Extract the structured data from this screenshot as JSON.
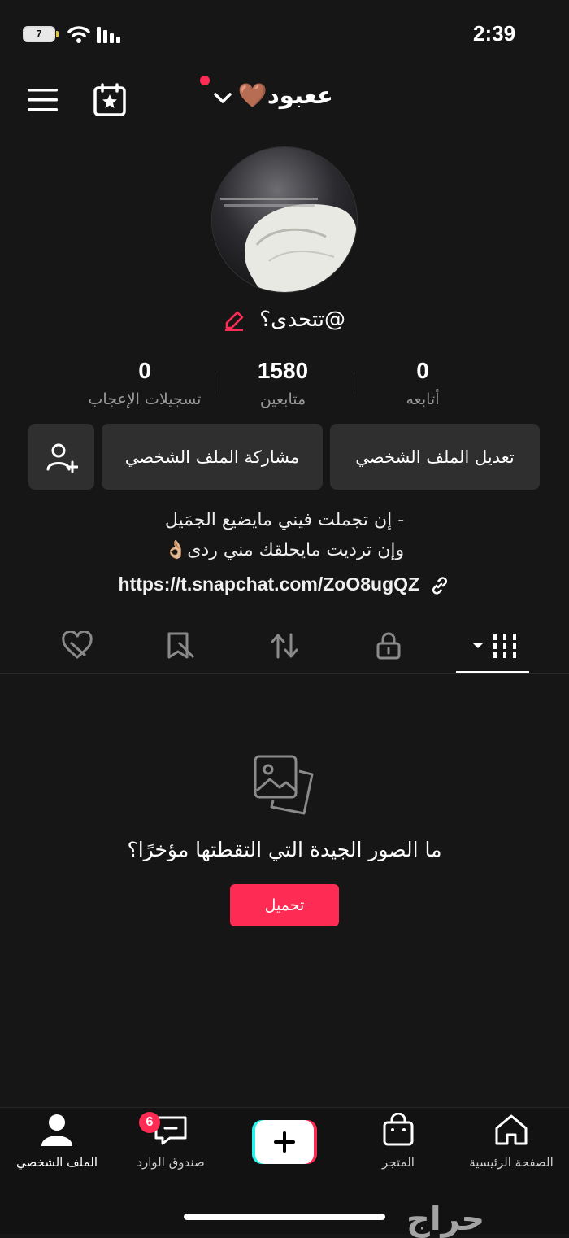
{
  "status": {
    "time": "2:39",
    "battery": "7"
  },
  "header": {
    "username": "ععبود🤎",
    "menu_icon": "hamburger-menu-icon",
    "calendar_icon": "calendar-star-icon"
  },
  "profile": {
    "handle": "@تتحدى؟",
    "stats": [
      {
        "value": "0",
        "label": "تسجيلات الإعجاب"
      },
      {
        "value": "1580",
        "label": "متابعين"
      },
      {
        "value": "0",
        "label": "أتابعه"
      }
    ],
    "edit_profile": "تعديل الملف الشخصي",
    "share_profile": "مشاركة الملف الشخصي",
    "bio_line1": "- إن تجملت فيني مايضيع الجمَيل",
    "bio_line2": "وإن ترديت مايحلقك مني ردى👌🏼",
    "link": "https://t.snapchat.com/ZoO8ugQZ"
  },
  "tabs": [
    "videos-grid",
    "private-lock",
    "reposts",
    "favorites",
    "liked"
  ],
  "empty_state": {
    "title": "ما الصور الجيدة التي التقطتها مؤخرًا؟",
    "button": "تحميل"
  },
  "bottom_nav": {
    "home": "الصفحة الرئيسية",
    "shop": "المتجر",
    "inbox": "صندوق الوارد",
    "inbox_badge": "6",
    "profile": "الملف الشخصي"
  },
  "watermark": "حراج",
  "colors": {
    "accent": "#fe2c55",
    "background": "#161616",
    "button": "#2f2f2f"
  }
}
